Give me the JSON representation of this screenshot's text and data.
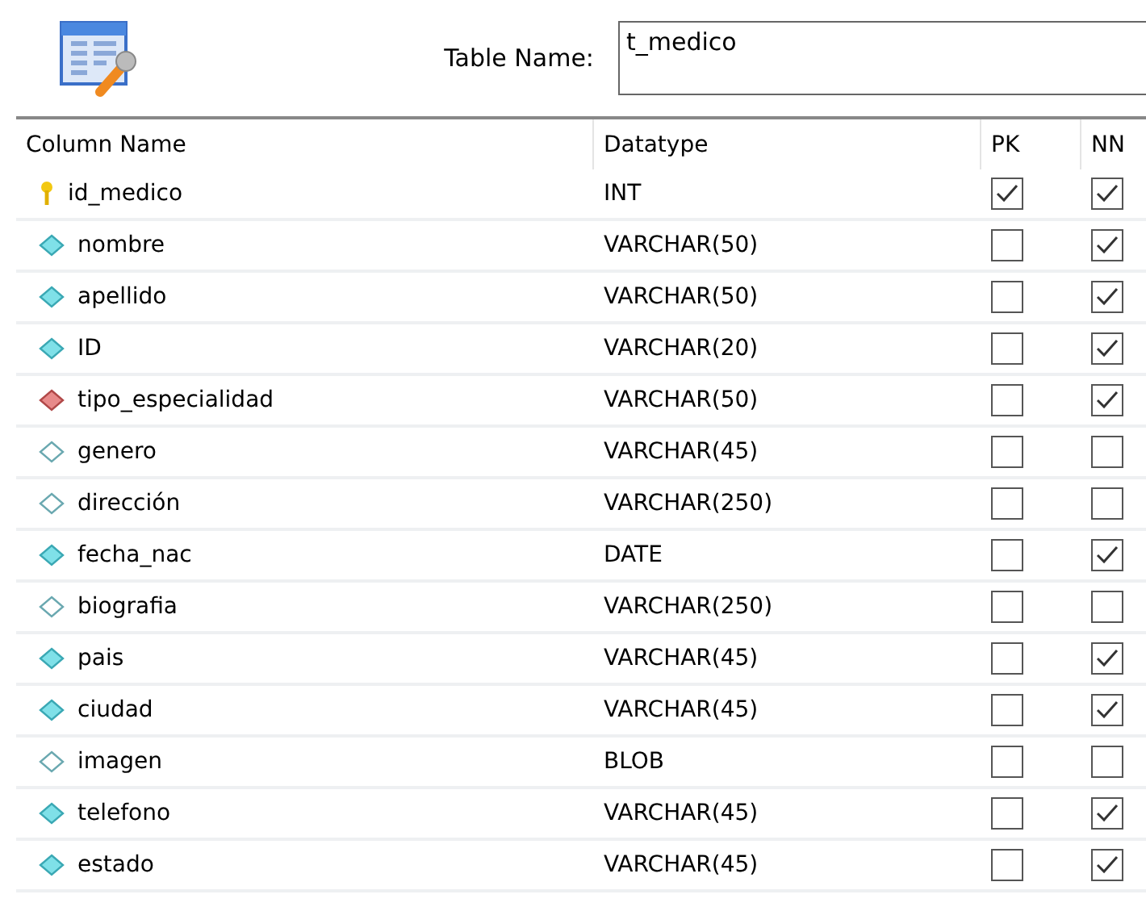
{
  "table_name": {
    "label": "Table Name:",
    "value": "t_medico"
  },
  "columns": [
    "Column Name",
    "Datatype",
    "PK",
    "NN"
  ],
  "rows": [
    {
      "kind": "key",
      "name": "id_medico",
      "datatype": "INT",
      "pk": true,
      "nn": true
    },
    {
      "kind": "filled",
      "name": "nombre",
      "datatype": "VARCHAR(50)",
      "pk": false,
      "nn": true
    },
    {
      "kind": "filled",
      "name": "apellido",
      "datatype": "VARCHAR(50)",
      "pk": false,
      "nn": true
    },
    {
      "kind": "filled",
      "name": "ID",
      "datatype": "VARCHAR(20)",
      "pk": false,
      "nn": true
    },
    {
      "kind": "foreign",
      "name": "tipo_especialidad",
      "datatype": "VARCHAR(50)",
      "pk": false,
      "nn": true
    },
    {
      "kind": "hollow",
      "name": "genero",
      "datatype": "VARCHAR(45)",
      "pk": false,
      "nn": false
    },
    {
      "kind": "hollow",
      "name": "dirección",
      "datatype": "VARCHAR(250)",
      "pk": false,
      "nn": false
    },
    {
      "kind": "filled",
      "name": "fecha_nac",
      "datatype": "DATE",
      "pk": false,
      "nn": true
    },
    {
      "kind": "hollow",
      "name": "biografia",
      "datatype": "VARCHAR(250)",
      "pk": false,
      "nn": false
    },
    {
      "kind": "filled",
      "name": "pais",
      "datatype": "VARCHAR(45)",
      "pk": false,
      "nn": true
    },
    {
      "kind": "filled",
      "name": "ciudad",
      "datatype": "VARCHAR(45)",
      "pk": false,
      "nn": true
    },
    {
      "kind": "hollow",
      "name": "imagen",
      "datatype": "BLOB",
      "pk": false,
      "nn": false
    },
    {
      "kind": "filled",
      "name": "telefono",
      "datatype": "VARCHAR(45)",
      "pk": false,
      "nn": true
    },
    {
      "kind": "filled",
      "name": "estado",
      "datatype": "VARCHAR(45)",
      "pk": false,
      "nn": true
    }
  ]
}
